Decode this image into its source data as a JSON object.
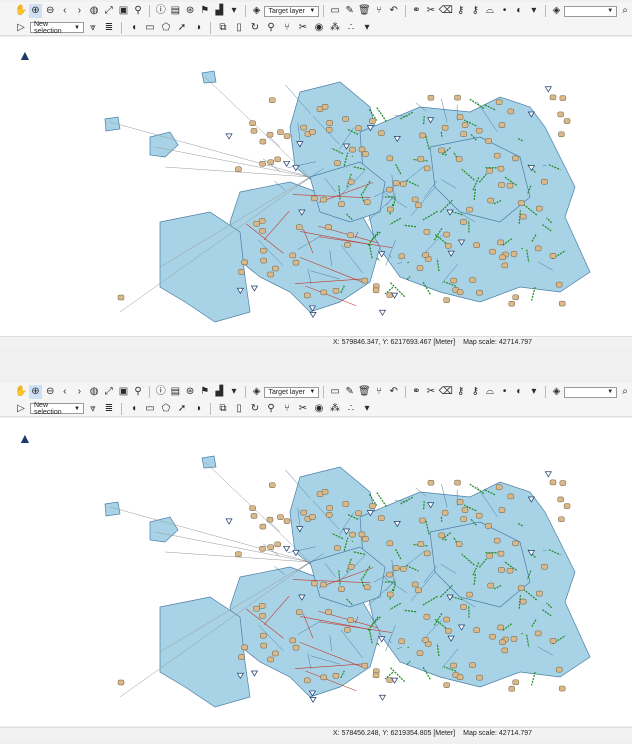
{
  "toolbar": {
    "target_layer_label": "Target layer",
    "selection_label": "New selection",
    "search_value": ""
  },
  "panels": [
    {
      "status": {
        "coords": "X: 579846.347, Y: 6217693.467 [Meter]",
        "scale": "Map scale: 42714.797"
      }
    },
    {
      "status": {
        "coords": "X: 578456.248, Y: 6219354.805 [Meter]",
        "scale": "Map scale: 42714.797"
      }
    }
  ],
  "colors": {
    "region_fill": "#a8d3e6",
    "region_stroke": "#4a7ea8",
    "network": "#1f8a1f",
    "links": "#c0392b",
    "node": "#d9b98a"
  }
}
